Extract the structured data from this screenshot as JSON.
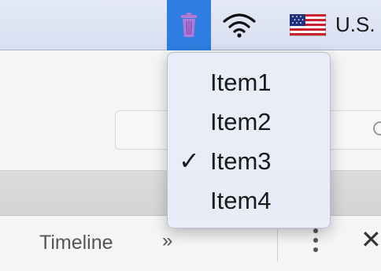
{
  "menubar": {
    "status_items": [
      {
        "name": "trash",
        "icon": "trash-icon",
        "active": true
      },
      {
        "name": "wifi",
        "icon": "wifi-icon"
      },
      {
        "name": "input-source",
        "icon": "us-flag-icon",
        "label": "U.S."
      }
    ]
  },
  "dropdown": {
    "items": [
      {
        "label": "Item1",
        "checked": false
      },
      {
        "label": "Item2",
        "checked": false
      },
      {
        "label": "Item3",
        "checked": true
      },
      {
        "label": "Item4",
        "checked": false
      }
    ],
    "check_glyph": "✓"
  },
  "toolbar": {
    "tab_label": "Timeline",
    "more_glyph": "»",
    "close_glyph": "✕"
  },
  "colors": {
    "accent": "#2f7de1",
    "trash_icon": "#b07ad8"
  }
}
